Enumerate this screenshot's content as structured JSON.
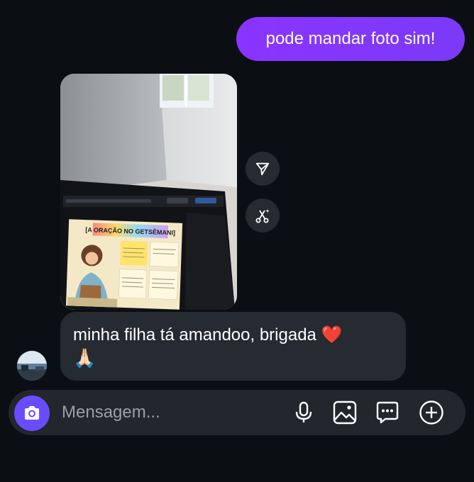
{
  "messages": {
    "outgoing_text": "pode mandar foto sim!",
    "incoming_text": "minha filha tá amandoo, brigada ❤️",
    "incoming_emoji": "🙏🏻",
    "photo_caption": "[A ORAÇÃO NO GETSÊMANI]"
  },
  "composer": {
    "placeholder": "Mensagem..."
  },
  "icons": {
    "share": "send-icon",
    "remix": "remix-icon",
    "camera": "camera-icon",
    "mic": "microphone-icon",
    "gallery": "gallery-icon",
    "sticker": "sticker-icon",
    "plus": "plus-icon"
  },
  "colors": {
    "background": "#0b0f14",
    "outgoing_bubble": "#8a34ff",
    "incoming_bubble": "#262a31",
    "camera_button": "#6a4cff"
  }
}
